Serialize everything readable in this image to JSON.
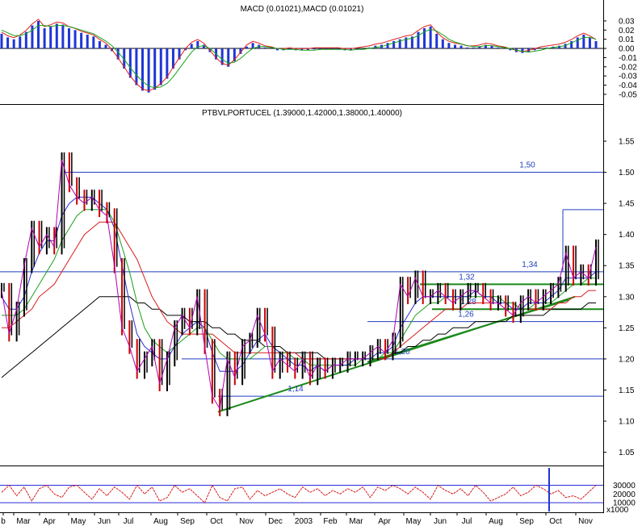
{
  "chart_data": [
    {
      "type": "bar",
      "title": "MACD (0.01021),MACD (0.01021)",
      "ylim": [
        -0.058,
        0.044
      ],
      "yticks": [
        0.03,
        0.02,
        0.01,
        0.0,
        -0.01,
        -0.02,
        -0.03,
        -0.04,
        -0.05
      ],
      "ytick_labels": [
        "0.03",
        "0.02",
        "0.01",
        "0.00",
        "-0.01",
        "-0.02",
        "-0.03",
        "-0.04",
        "-0.05"
      ],
      "series": [
        {
          "values": [
            0.016,
            0.012,
            0.01,
            0.013,
            0.018,
            0.025,
            0.03,
            0.022,
            0.024,
            0.027,
            0.026,
            0.022,
            0.02,
            0.017,
            0.015,
            0.013,
            0.008,
            0.004,
            -0.003,
            -0.012,
            -0.022,
            -0.032,
            -0.04,
            -0.046,
            -0.048,
            -0.045,
            -0.04,
            -0.033,
            -0.022,
            -0.012,
            -0.002,
            0.005,
            0.008,
            0.004,
            -0.004,
            -0.012,
            -0.018,
            -0.02,
            -0.014,
            -0.006,
            0.002,
            0.006,
            0.004,
            0.001,
            0.0,
            -0.002,
            -0.002,
            -0.001,
            -0.002,
            -0.002,
            -0.002,
            -0.001,
            -0.001,
            -0.001,
            -0.001,
            -0.001,
            -0.002,
            -0.002,
            -0.001,
            0.0,
            0.001,
            0.003,
            0.004,
            0.006,
            0.008,
            0.01,
            0.012,
            0.013,
            0.018,
            0.022,
            0.024,
            0.016,
            0.01,
            0.006,
            0.004,
            0.003,
            0.001,
            0.001,
            0.002,
            0.004,
            0.003,
            0.001,
            0.0,
            -0.002,
            -0.004,
            -0.005,
            -0.004,
            -0.002,
            0.0,
            0.001,
            0.002,
            0.003,
            0.005,
            0.008,
            0.012,
            0.015,
            0.012,
            0.008
          ]
        },
        {
          "values": [
            0.02,
            0.017,
            0.014,
            0.014,
            0.016,
            0.02,
            0.025,
            0.025,
            0.024,
            0.025,
            0.025,
            0.024,
            0.022,
            0.02,
            0.018,
            0.016,
            0.012,
            0.008,
            0.003,
            -0.004,
            -0.012,
            -0.021,
            -0.029,
            -0.036,
            -0.041,
            -0.043,
            -0.042,
            -0.038,
            -0.031,
            -0.022,
            -0.013,
            -0.004,
            0.002,
            0.003,
            0.0,
            -0.006,
            -0.012,
            -0.016,
            -0.015,
            -0.011,
            -0.005,
            0.0,
            0.002,
            0.002,
            0.001,
            0.0,
            -0.001,
            -0.001,
            -0.001,
            -0.002,
            -0.002,
            -0.002,
            -0.001,
            -0.001,
            -0.001,
            -0.001,
            -0.001,
            -0.002,
            -0.001,
            -0.001,
            0.0,
            0.001,
            0.002,
            0.004,
            0.006,
            0.008,
            0.01,
            0.011,
            0.014,
            0.018,
            0.021,
            0.019,
            0.015,
            0.01,
            0.007,
            0.005,
            0.003,
            0.002,
            0.002,
            0.003,
            0.003,
            0.002,
            0.001,
            0.0,
            -0.002,
            -0.003,
            -0.004,
            -0.003,
            -0.002,
            0.0,
            0.001,
            0.002,
            0.003,
            0.006,
            0.009,
            0.012,
            0.012,
            0.01
          ]
        }
      ]
    },
    {
      "type": "line",
      "title": "PTBVLPORTUCEL (1.39000,1.42000,1.38000,1.40000)",
      "ylim": [
        1.03,
        1.585
      ],
      "yticks": [
        1.05,
        1.1,
        1.15,
        1.2,
        1.25,
        1.3,
        1.35,
        1.4,
        1.45,
        1.5,
        1.55
      ],
      "ytick_labels": [
        "1.05",
        "1.10",
        "1.15",
        "1.20",
        "1.25",
        "1.30",
        "1.35",
        "1.40",
        "1.45",
        "1.50",
        "1.55"
      ],
      "x_labels": [
        "b",
        "Mar",
        "Apr",
        "May",
        "Jun",
        "Jul",
        "Aug",
        "Sep",
        "Oct",
        "Nov",
        "Dec",
        "2003",
        "Feb",
        "Mar",
        "Apr",
        "May",
        "Jun",
        "Jul",
        "Aug",
        "Sep",
        "Oct",
        "Nov"
      ],
      "level_labels": [
        "1,50",
        "1,34",
        "1,32",
        "1,28",
        "1,26",
        "1,20",
        "1,14"
      ],
      "horizontal_levels": [
        1.5,
        1.34,
        1.32,
        1.28,
        1.26,
        1.2,
        1.14,
        1.44
      ],
      "series": [
        {
          "values": [
            1.31,
            1.24,
            1.28,
            1.35,
            1.41,
            1.38,
            1.4,
            1.38,
            1.52,
            1.48,
            1.46,
            1.45,
            1.46,
            1.44,
            1.43,
            1.35,
            1.25,
            1.22,
            1.18,
            1.2,
            1.22,
            1.16,
            1.2,
            1.25,
            1.27,
            1.25,
            1.3,
            1.22,
            1.14,
            1.12,
            1.2,
            1.17,
            1.22,
            1.23,
            1.27,
            1.24,
            1.18,
            1.2,
            1.19,
            1.18,
            1.2,
            1.17,
            1.19,
            1.18,
            1.19,
            1.19,
            1.2,
            1.2,
            1.2,
            1.21,
            1.22,
            1.21,
            1.23,
            1.32,
            1.3,
            1.33,
            1.3,
            1.3,
            1.31,
            1.3,
            1.29,
            1.3,
            1.31,
            1.31,
            1.3,
            1.29,
            1.29,
            1.28,
            1.27,
            1.29,
            1.3,
            1.29,
            1.3,
            1.31,
            1.32,
            1.37,
            1.33,
            1.34,
            1.33,
            1.38
          ]
        },
        {
          "values": [
            1.3,
            1.28,
            1.28,
            1.3,
            1.34,
            1.37,
            1.39,
            1.39,
            1.43,
            1.45,
            1.46,
            1.46,
            1.46,
            1.45,
            1.44,
            1.41,
            1.35,
            1.29,
            1.24,
            1.22,
            1.21,
            1.2,
            1.2,
            1.22,
            1.24,
            1.25,
            1.26,
            1.25,
            1.21,
            1.18,
            1.18,
            1.18,
            1.19,
            1.21,
            1.23,
            1.24,
            1.22,
            1.21,
            1.2,
            1.19,
            1.19,
            1.18,
            1.19,
            1.18,
            1.19,
            1.19,
            1.19,
            1.2,
            1.2,
            1.2,
            1.21,
            1.21,
            1.22,
            1.25,
            1.27,
            1.29,
            1.3,
            1.3,
            1.3,
            1.3,
            1.3,
            1.3,
            1.3,
            1.31,
            1.3,
            1.3,
            1.29,
            1.29,
            1.28,
            1.28,
            1.29,
            1.29,
            1.29,
            1.3,
            1.31,
            1.33,
            1.33,
            1.33,
            1.33,
            1.34
          ]
        },
        {
          "values": [
            1.27,
            1.27,
            1.27,
            1.28,
            1.3,
            1.32,
            1.34,
            1.36,
            1.39,
            1.41,
            1.43,
            1.44,
            1.44,
            1.44,
            1.44,
            1.42,
            1.38,
            1.34,
            1.29,
            1.25,
            1.23,
            1.22,
            1.21,
            1.22,
            1.23,
            1.24,
            1.25,
            1.25,
            1.23,
            1.21,
            1.2,
            1.2,
            1.2,
            1.2,
            1.21,
            1.22,
            1.22,
            1.21,
            1.21,
            1.2,
            1.2,
            1.19,
            1.19,
            1.19,
            1.19,
            1.19,
            1.19,
            1.19,
            1.2,
            1.2,
            1.2,
            1.21,
            1.21,
            1.23,
            1.25,
            1.27,
            1.28,
            1.29,
            1.29,
            1.3,
            1.3,
            1.3,
            1.3,
            1.3,
            1.3,
            1.3,
            1.3,
            1.29,
            1.29,
            1.28,
            1.28,
            1.29,
            1.29,
            1.29,
            1.3,
            1.31,
            1.32,
            1.32,
            1.33,
            1.33
          ]
        },
        {
          "values": [
            1.25,
            1.25,
            1.26,
            1.27,
            1.28,
            1.3,
            1.31,
            1.32,
            1.34,
            1.36,
            1.38,
            1.4,
            1.41,
            1.42,
            1.42,
            1.42,
            1.4,
            1.38,
            1.36,
            1.33,
            1.3,
            1.28,
            1.26,
            1.25,
            1.24,
            1.24,
            1.24,
            1.24,
            1.24,
            1.23,
            1.22,
            1.21,
            1.21,
            1.21,
            1.21,
            1.21,
            1.21,
            1.21,
            1.21,
            1.21,
            1.2,
            1.2,
            1.2,
            1.2,
            1.2,
            1.2,
            1.2,
            1.2,
            1.2,
            1.2,
            1.2,
            1.2,
            1.21,
            1.22,
            1.23,
            1.24,
            1.25,
            1.26,
            1.27,
            1.28,
            1.28,
            1.28,
            1.29,
            1.29,
            1.29,
            1.29,
            1.29,
            1.29,
            1.29,
            1.28,
            1.28,
            1.28,
            1.28,
            1.28,
            1.29,
            1.29,
            1.3,
            1.3,
            1.31,
            1.31
          ]
        },
        {
          "values": [
            1.17,
            1.18,
            1.19,
            1.2,
            1.21,
            1.22,
            1.23,
            1.24,
            1.25,
            1.26,
            1.27,
            1.28,
            1.29,
            1.3,
            1.3,
            1.3,
            1.3,
            1.3,
            1.29,
            1.29,
            1.28,
            1.28,
            1.27,
            1.27,
            1.27,
            1.26,
            1.26,
            1.26,
            1.25,
            1.25,
            1.24,
            1.24,
            1.23,
            1.23,
            1.23,
            1.22,
            1.22,
            1.22,
            1.21,
            1.21,
            1.21,
            1.21,
            1.21,
            1.2,
            1.2,
            1.2,
            1.2,
            1.2,
            1.2,
            1.2,
            1.2,
            1.2,
            1.21,
            1.21,
            1.22,
            1.22,
            1.23,
            1.23,
            1.24,
            1.24,
            1.25,
            1.25,
            1.25,
            1.26,
            1.26,
            1.26,
            1.26,
            1.26,
            1.27,
            1.27,
            1.27,
            1.27,
            1.27,
            1.28,
            1.28,
            1.28,
            1.28,
            1.28,
            1.29,
            1.29
          ]
        }
      ]
    },
    {
      "type": "line",
      "title": "",
      "ylim": [
        0,
        48000
      ],
      "yticks": [
        30000,
        20000,
        10000
      ],
      "ytick_labels": [
        "30000",
        "20000",
        "10000"
      ],
      "unit_label": "x1000",
      "guide_levels": [
        30000,
        10000
      ],
      "series": [
        {
          "values": [
            22000,
            30000,
            18000,
            28000,
            12000,
            26000,
            30000,
            20000,
            16000,
            28000,
            30000,
            22000,
            14000,
            26000,
            18000,
            28000,
            22000,
            14000,
            30000,
            20000,
            28000,
            12000,
            16000,
            30000,
            22000,
            26000,
            18000,
            10000,
            30000,
            16000,
            12000,
            26000,
            28000,
            14000,
            24000,
            18000,
            22000,
            26000,
            20000,
            16000,
            28000,
            22000,
            26000,
            18000,
            24000,
            20000,
            26000,
            22000,
            28000,
            16000,
            28000,
            24000,
            30000,
            26000,
            20000,
            28000,
            22000,
            14000,
            30000,
            24000,
            20000,
            26000,
            18000,
            30000,
            22000,
            12000,
            16000,
            20000,
            28000,
            18000,
            22000,
            30000,
            26000,
            20000,
            24000,
            16000,
            18000,
            14000,
            22000,
            30000
          ]
        }
      ]
    }
  ]
}
